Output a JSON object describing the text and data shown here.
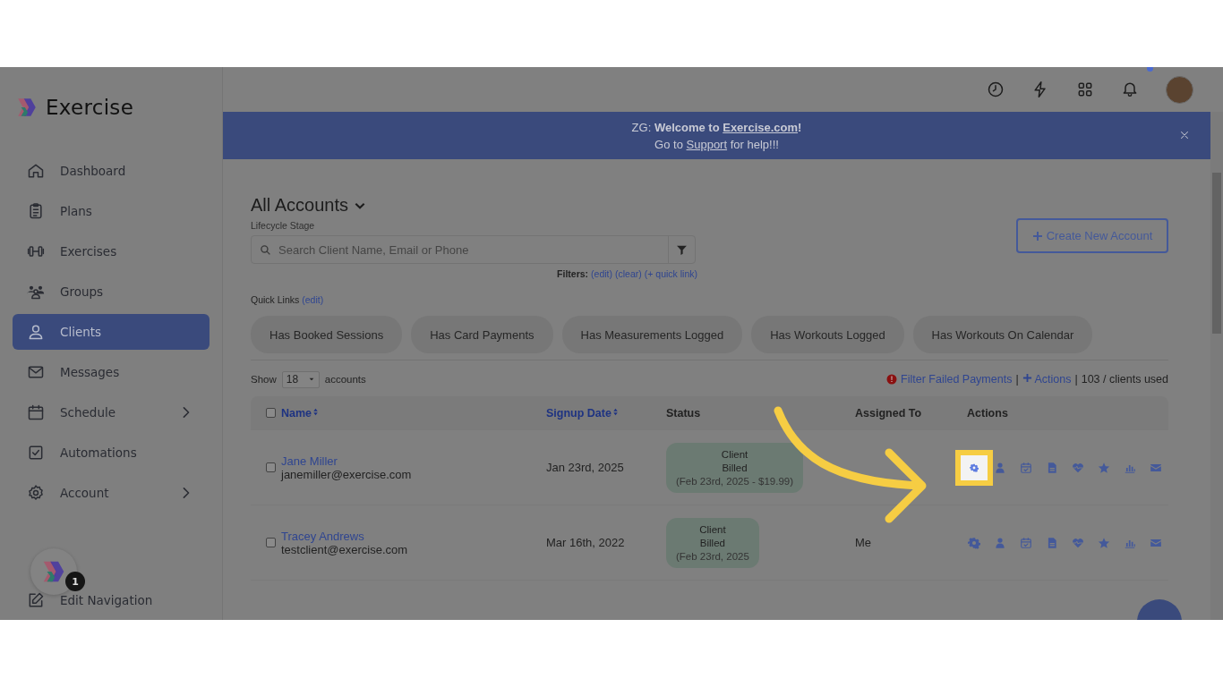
{
  "app": {
    "name": "Exercise"
  },
  "sidebar": {
    "items": [
      {
        "label": "Dashboard",
        "selected": false,
        "has_submenu": false
      },
      {
        "label": "Plans",
        "selected": false,
        "has_submenu": false
      },
      {
        "label": "Exercises",
        "selected": false,
        "has_submenu": false
      },
      {
        "label": "Groups",
        "selected": false,
        "has_submenu": false
      },
      {
        "label": "Clients",
        "selected": true,
        "has_submenu": false
      },
      {
        "label": "Messages",
        "selected": false,
        "has_submenu": false
      },
      {
        "label": "Schedule",
        "selected": false,
        "has_submenu": true
      },
      {
        "label": "Automations",
        "selected": false,
        "has_submenu": false
      },
      {
        "label": "Account",
        "selected": false,
        "has_submenu": true
      }
    ],
    "helper_badge": "1",
    "edit_navigation": "Edit Navigation"
  },
  "topbar": {
    "has_unread_notifications": true
  },
  "banner": {
    "prefix": "ZG:",
    "bold_text": "Welcome to",
    "link": "Exercise.com",
    "suffix": "!",
    "line2_before": "Go to",
    "line2_link": "Support",
    "line2_after": "for help!!!"
  },
  "page": {
    "title": "All Accounts",
    "subtitle": "Lifecycle Stage",
    "search": {
      "placeholder": "Search Client Name, Email or Phone"
    },
    "filters_label": "Filters:",
    "filter_links": [
      "(edit)",
      "(clear)",
      "(+ quick link)"
    ],
    "create_button": "Create New Account",
    "quick_links_label": "Quick Links",
    "quick_links_edit": "(edit)",
    "quick_links": [
      "Has Booked Sessions",
      "Has Card Payments",
      "Has Measurements Logged",
      "Has Workouts Logged",
      "Has Workouts On Calendar"
    ],
    "show_label": "Show",
    "page_size": "18",
    "show_suffix": "accounts",
    "failed_payments_link": "Filter Failed Payments",
    "separators": [
      "|",
      "|"
    ],
    "actions_link": "Actions",
    "usage": "103 / clients used"
  },
  "table": {
    "select_all_checked": false,
    "columns": [
      {
        "label": "Name",
        "sortable": true
      },
      {
        "label": "Signup Date",
        "sortable": true
      },
      {
        "label": "Status",
        "sortable": false
      },
      {
        "label": "Assigned To",
        "sortable": false
      },
      {
        "label": "Actions",
        "sortable": false
      }
    ],
    "rows": [
      {
        "checked": false,
        "name": "Jane Miller",
        "email": "janemiller@exercise.com",
        "signup_date": "Jan 23rd, 2025",
        "status": [
          "Client",
          "Billed",
          "(Feb 23rd, 2025 - $19.99)"
        ],
        "gear_highlighted": true
      },
      {
        "checked": false,
        "name": "Tracey Andrews",
        "email": "testclient@exercise.com",
        "signup_date": "Mar 16th, 2022",
        "status": [
          "Client",
          "Billed",
          "(Feb 23rd, 2025"
        ],
        "assigned_to": "Me",
        "gear_highlighted": false
      }
    ]
  }
}
